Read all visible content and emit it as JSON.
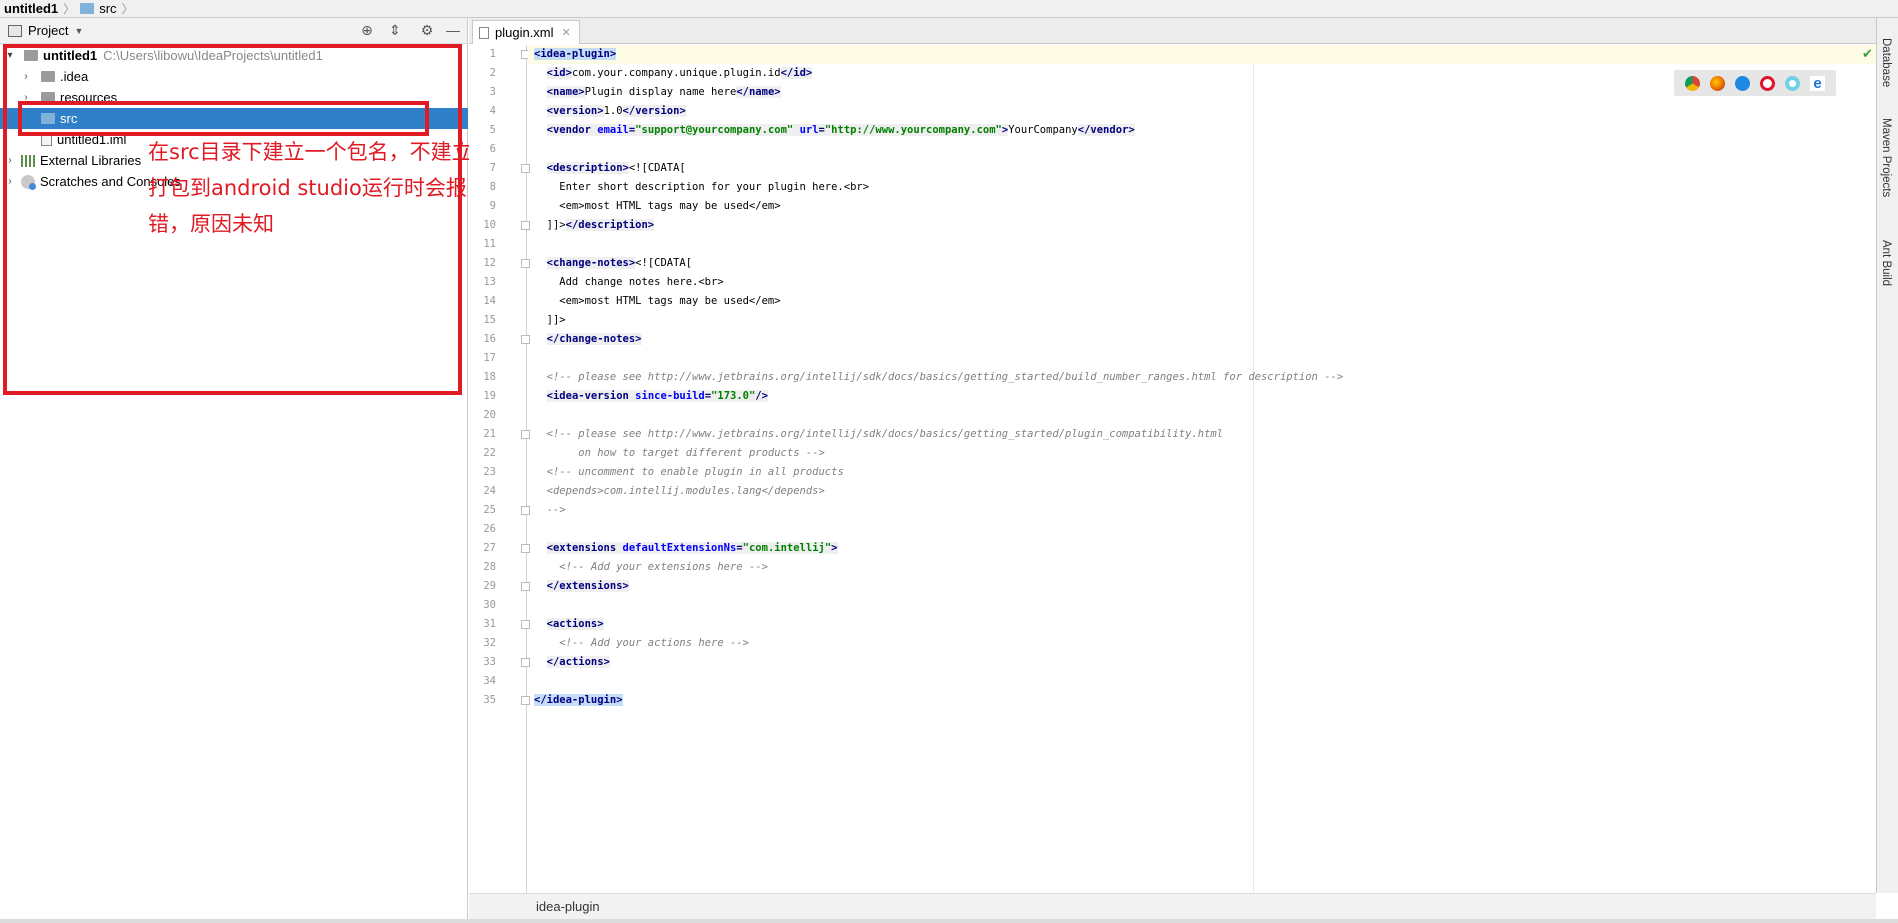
{
  "breadcrumb": {
    "project": "untitled1",
    "folder": "src"
  },
  "project_panel": {
    "title": "Project",
    "tree": {
      "root_label": "untitled1",
      "root_path": "C:\\Users\\libowu\\IdeaProjects\\untitled1",
      "items": [
        ".idea",
        "resources",
        "src",
        "untitled1.iml"
      ],
      "external_libraries": "External Libraries",
      "scratches": "Scratches and Consoles"
    }
  },
  "annotation": "在src目录下建立一个包名，不建立打包到android studio运行时会报错，原因未知",
  "editor": {
    "tab_label": "plugin.xml",
    "line_numbers": [
      "1",
      "2",
      "3",
      "4",
      "5",
      "6",
      "7",
      "8",
      "9",
      "10",
      "11",
      "12",
      "13",
      "14",
      "15",
      "16",
      "17",
      "18",
      "19",
      "20",
      "21",
      "22",
      "23",
      "24",
      "25",
      "26",
      "27",
      "28",
      "29",
      "30",
      "31",
      "32",
      "33",
      "34",
      "35"
    ],
    "code": {
      "l1": "idea-plugin",
      "l2_tag": "id",
      "l2_text": "com.your.company.unique.plugin.id",
      "l3_tag": "name",
      "l3_text": "Plugin display name here",
      "l4_tag": "version",
      "l4_text": "1.0",
      "l5_tag": "vendor",
      "l5_attr1": "email",
      "l5_val1": "\"support@yourcompany.com\"",
      "l5_attr2": "url",
      "l5_val2": "\"http://www.yourcompany.com\"",
      "l5_text": "YourCompany",
      "l7_tag": "description",
      "l7_text": "<![CDATA[",
      "l8": "    Enter short description for your plugin here.<br>",
      "l9": "    <em>most HTML tags may be used</em>",
      "l10_text": "  ]]>",
      "l10_tag": "/description",
      "l12_tag": "change-notes",
      "l12_text": "<![CDATA[",
      "l13": "    Add change notes here.<br>",
      "l14": "    <em>most HTML tags may be used</em>",
      "l15": "  ]]>",
      "l16_tag": "/change-notes",
      "l18": "<!-- please see http://www.jetbrains.org/intellij/sdk/docs/basics/getting_started/build_number_ranges.html for description -->",
      "l19_tag": "idea-version",
      "l19_attr": "since-build",
      "l19_val": "\"173.0\"",
      "l21": "<!-- please see http://www.jetbrains.org/intellij/sdk/docs/basics/getting_started/plugin_compatibility.html",
      "l22": "     on how to target different products -->",
      "l23": "<!-- uncomment to enable plugin in all products",
      "l24": "<depends>com.intellij.modules.lang</depends>",
      "l25": "-->",
      "l27_tag": "extensions",
      "l27_attr": "defaultExtensionNs",
      "l27_val": "\"com.intellij\"",
      "l28": "  <!-- Add your extensions here -->",
      "l29_tag": "/extensions",
      "l31_tag": "actions",
      "l32": "  <!-- Add your actions here -->",
      "l33_tag": "/actions",
      "l35_tag": "/idea-plugin"
    }
  },
  "right_toolbar": [
    "Database",
    "Maven Projects",
    "Ant Build"
  ],
  "status": {
    "path": "idea-plugin"
  },
  "colors": {
    "selection": "#2f80c8",
    "annotation_red": "#e01b24"
  }
}
